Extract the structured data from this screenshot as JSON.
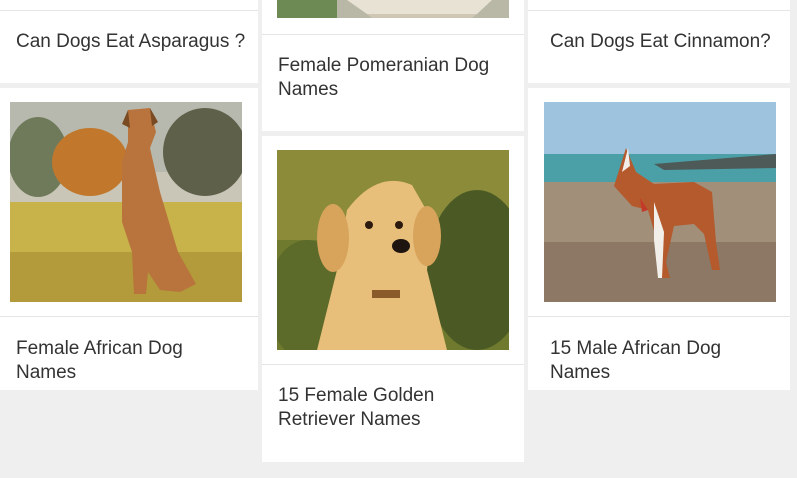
{
  "cards": {
    "asparagus": {
      "title": "Can Dogs Eat Asparagus ?",
      "image_icon": ""
    },
    "pomeranian": {
      "title": "Female Pomeranian Dog Names",
      "image_icon": "dog-bed-photo"
    },
    "cinnamon": {
      "title": "Can Dogs Eat Cinnamon?",
      "image_icon": ""
    },
    "african_female": {
      "title": "Female African Dog Names",
      "image_icon": "ridgeback-dog-photo"
    },
    "golden": {
      "title": "15 Female Golden Retriever Names",
      "image_icon": "golden-retriever-puppy-photo"
    },
    "african_male": {
      "title": "15 Male African Dog Names",
      "image_icon": "basenji-dog-beach-photo"
    }
  },
  "colors": {
    "page_bg": "#efefef",
    "card_bg": "#ffffff",
    "text": "#333333"
  }
}
